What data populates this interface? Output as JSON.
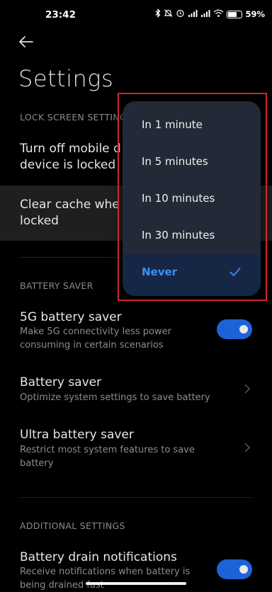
{
  "status_bar": {
    "time": "23:42",
    "battery_percent": "59%",
    "battery_level": 0.59,
    "icons": [
      "bluetooth-icon",
      "mute-icon",
      "alarm-icon",
      "signal-icon",
      "signal-icon",
      "wifi-icon",
      "battery-icon"
    ]
  },
  "header": {
    "title": "Settings"
  },
  "lock_screen": {
    "section_label": "LOCK SCREEN SETTING",
    "item1_line1": "Turn off mobile d",
    "item1_line2": "device is locked",
    "item2_line1": "Clear cache whe",
    "item2_line2": "locked"
  },
  "battery_saver": {
    "section_label": "BATTERY SAVER",
    "items": [
      {
        "title": "5G battery saver",
        "sub1": "Make 5G connectivity less power",
        "sub2": "consuming in certain scenarios",
        "toggle_on": true
      },
      {
        "title": "Battery saver",
        "sub1": "Optimize system settings to save battery",
        "sub2": ""
      },
      {
        "title": "Ultra battery saver",
        "sub1": "Restrict most system features to save",
        "sub2": "battery"
      }
    ]
  },
  "additional": {
    "section_label": "ADDITIONAL SETTINGS",
    "item_title": "Battery drain notifications",
    "item_sub1": "Receive notifications when battery is",
    "item_sub2": "being drained fast",
    "toggle_on": true
  },
  "dropdown": {
    "options": [
      "In 1 minute",
      "In 5 minutes",
      "In 10 minutes",
      "In 30 minutes",
      "Never"
    ],
    "selected": "Never"
  },
  "colors": {
    "accent": "#3d8ef5",
    "toggle": "#1e62d8",
    "highlight_border": "#d12633"
  }
}
